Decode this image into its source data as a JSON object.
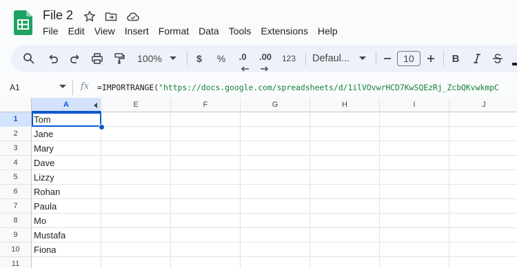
{
  "app": {
    "file_title": "File 2",
    "menu": [
      "File",
      "Edit",
      "View",
      "Insert",
      "Format",
      "Data",
      "Tools",
      "Extensions",
      "Help"
    ]
  },
  "toolbar": {
    "zoom": "100%",
    "currency": "$",
    "percent": "%",
    "decimal_decrease": ".0",
    "decimal_increase": ".00",
    "number_format": "123",
    "font": "Defaul...",
    "font_size": "10",
    "bold": "B"
  },
  "formula_bar": {
    "name_box": "A1",
    "fx": "fx",
    "formula_prefix": "=IMPORTRANGE(",
    "formula_string": "\"https://docs.google.com/spreadsheets/d/1ilVOvwrHCD7KwSQEzRj_ZcbQKvwkmpC"
  },
  "grid": {
    "columns": [
      "A",
      "E",
      "F",
      "G",
      "H",
      "I",
      "J"
    ],
    "rows": [
      {
        "num": "1",
        "A": "Tom"
      },
      {
        "num": "2",
        "A": "Jane"
      },
      {
        "num": "3",
        "A": "Mary"
      },
      {
        "num": "4",
        "A": "Dave"
      },
      {
        "num": "5",
        "A": "Lizzy"
      },
      {
        "num": "6",
        "A": "Rohan"
      },
      {
        "num": "7",
        "A": "Paula"
      },
      {
        "num": "8",
        "A": "Mo"
      },
      {
        "num": "9",
        "A": "Mustafa"
      },
      {
        "num": "10",
        "A": "Fiona"
      },
      {
        "num": "11",
        "A": ""
      }
    ]
  },
  "colors": {
    "accent": "#0b57d0",
    "selected_header": "#d3e3fd",
    "toolbar_bg": "#edf2fa",
    "sheets_green": "#188038"
  }
}
